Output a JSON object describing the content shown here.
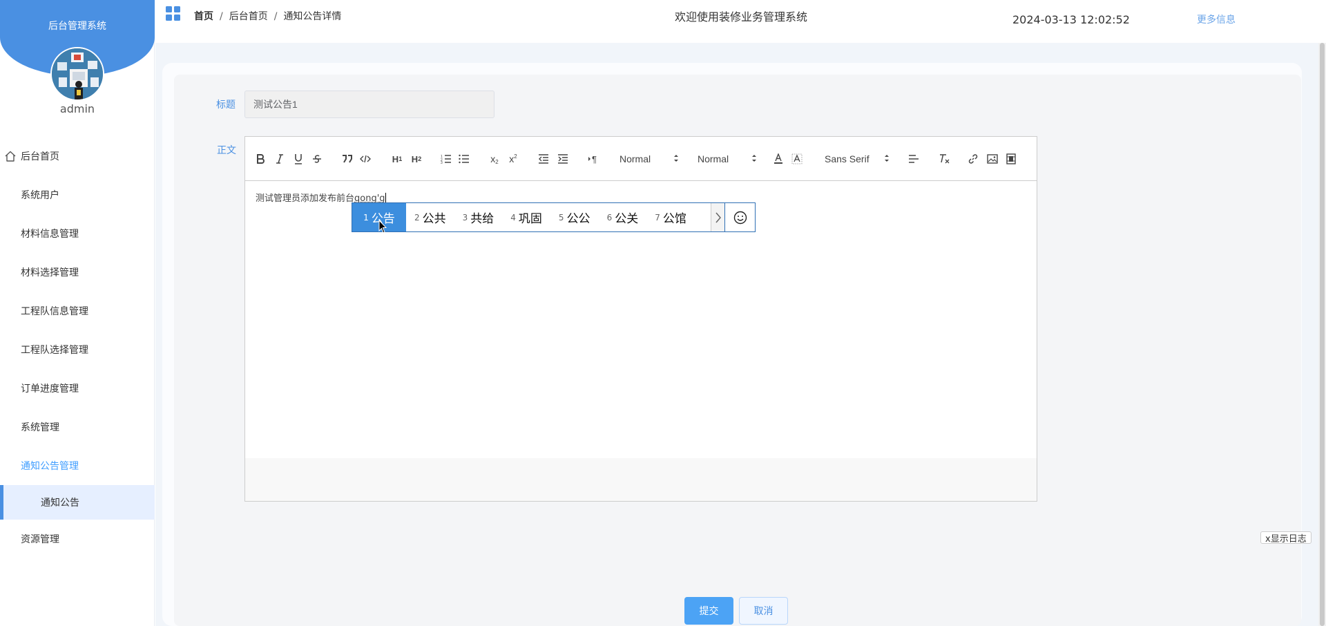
{
  "sidebar": {
    "system_title": "后台管理系统",
    "username": "admin",
    "items": [
      {
        "label": "后台首页"
      },
      {
        "label": "系统用户"
      },
      {
        "label": "材料信息管理"
      },
      {
        "label": "材料选择管理"
      },
      {
        "label": "工程队信息管理"
      },
      {
        "label": "工程队选择管理"
      },
      {
        "label": "订单进度管理"
      },
      {
        "label": "系统管理"
      },
      {
        "label": "通知公告管理"
      },
      {
        "label": "资源管理"
      }
    ],
    "sub_item": {
      "label": "通知公告"
    }
  },
  "header": {
    "breadcrumb": [
      "首页",
      "后台首页",
      "通知公告详情"
    ],
    "breadcrumb_separator": "/",
    "welcome": "欢迎使用装修业务管理系统",
    "datetime": "2024-03-13 12:02:52",
    "more_info": "更多信息"
  },
  "form": {
    "title_label": "标题",
    "title_value": "测试公告1",
    "content_label": "正文",
    "content_text": "测试管理员添加发布前台",
    "composition_text": "gong'g"
  },
  "toolbar": {
    "header_select": "Normal",
    "size_select": "Normal",
    "font_select": "Sans Serif"
  },
  "ime": {
    "candidates": [
      {
        "num": "1",
        "text": "公告"
      },
      {
        "num": "2",
        "text": "公共"
      },
      {
        "num": "3",
        "text": "共给"
      },
      {
        "num": "4",
        "text": "巩固"
      },
      {
        "num": "5",
        "text": "公公"
      },
      {
        "num": "6",
        "text": "公关"
      },
      {
        "num": "7",
        "text": "公馆"
      }
    ]
  },
  "actions": {
    "submit": "提交",
    "cancel": "取消",
    "show_log": "x显示日志"
  },
  "colors": {
    "accent": "#4a90e2",
    "submit_bg": "#4ca3f5"
  }
}
